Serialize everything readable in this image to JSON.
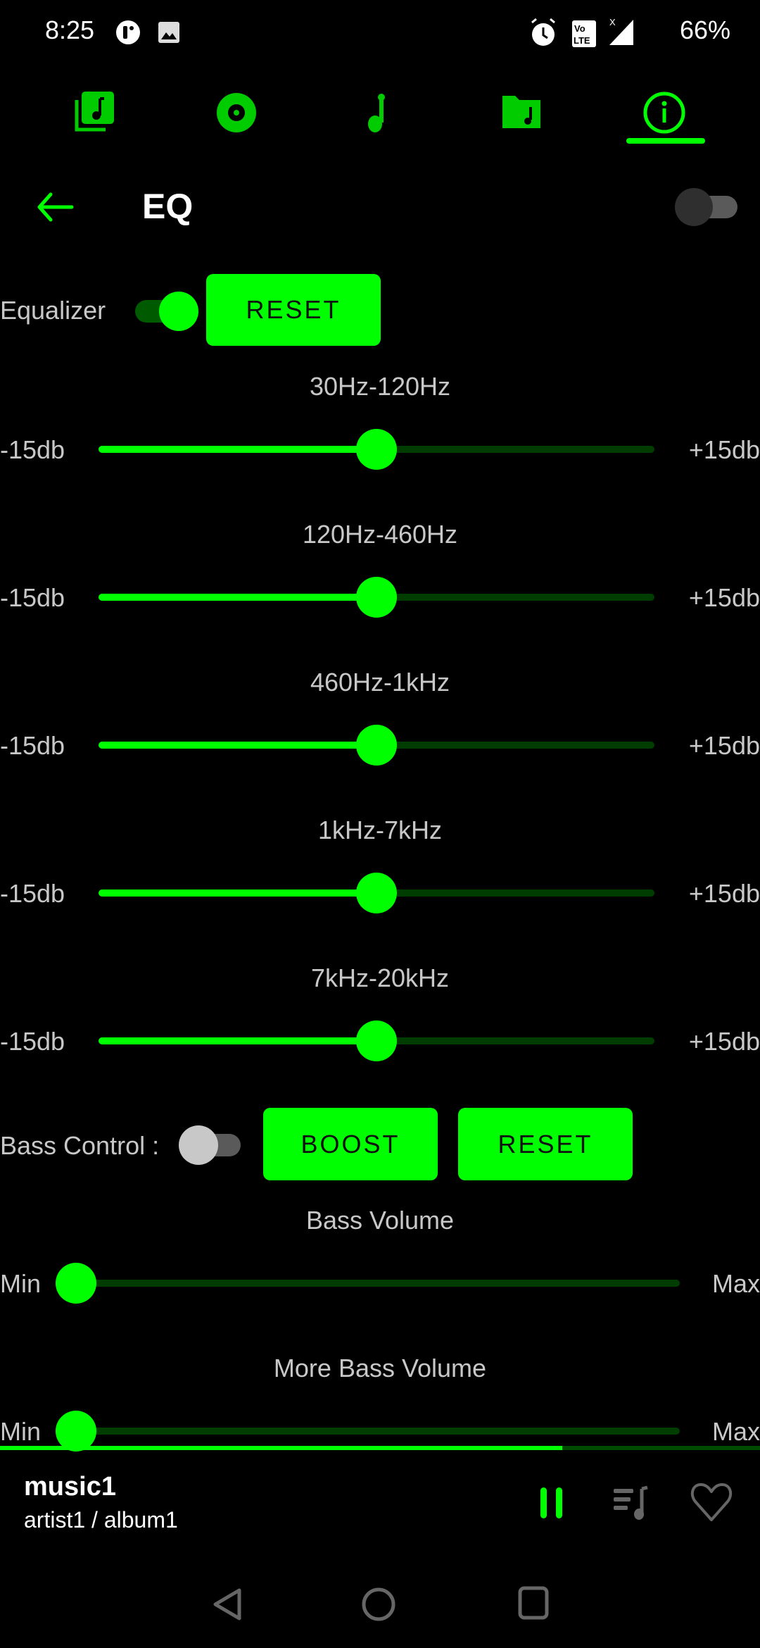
{
  "status_bar": {
    "time": "8:25",
    "left_icons": [
      "notification-app-icon",
      "image-icon"
    ],
    "right_icons": [
      "alarm-icon",
      "volte-icon",
      "signal-icon"
    ],
    "battery": "66%"
  },
  "top_nav": {
    "tabs": [
      {
        "icon": "playlist-icon",
        "active": false
      },
      {
        "icon": "album-icon",
        "active": false
      },
      {
        "icon": "music-note-icon",
        "active": false
      },
      {
        "icon": "folder-music-icon",
        "active": false
      },
      {
        "icon": "info-icon",
        "active": true
      }
    ],
    "accent": "#00ff00"
  },
  "header": {
    "title": "EQ",
    "master_switch_on": false
  },
  "equalizer": {
    "label": "Equalizer",
    "enabled": true,
    "reset_label": "RESET",
    "min_label": "-15db",
    "max_label": "+15db",
    "min_db": -15,
    "max_db": 15,
    "bands": [
      {
        "name": "30Hz-120Hz",
        "value_db": 0
      },
      {
        "name": "120Hz-460Hz",
        "value_db": 0
      },
      {
        "name": "460Hz-1kHz",
        "value_db": 0
      },
      {
        "name": "1kHz-7kHz",
        "value_db": 0
      },
      {
        "name": "7kHz-20kHz",
        "value_db": 0
      }
    ]
  },
  "bass": {
    "label": "Bass Control :",
    "enabled": false,
    "boost_label": "BOOST",
    "reset_label": "RESET",
    "sliders": [
      {
        "name": "Bass Volume",
        "min_label": "Min",
        "max_label": "Max",
        "value_fraction": 0
      },
      {
        "name": "More Bass Volume",
        "min_label": "Min",
        "max_label": "Max",
        "value_fraction": 0
      }
    ]
  },
  "player": {
    "progress_fraction": 0.74,
    "title": "music1",
    "subtitle": "artist1 / album1",
    "state": "playing"
  }
}
